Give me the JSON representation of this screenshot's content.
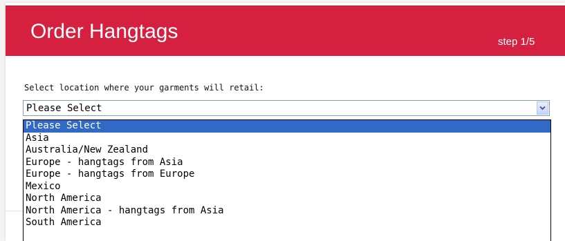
{
  "header": {
    "title": "Order Hangtags",
    "step": "step 1/5"
  },
  "form": {
    "location_label": "Select location where your garments will retail:",
    "location_value": "Please Select"
  },
  "dropdown": {
    "options": [
      {
        "label": "Please Select",
        "selected": true
      },
      {
        "label": "Asia",
        "selected": false
      },
      {
        "label": "Australia/New Zealand",
        "selected": false
      },
      {
        "label": "Europe - hangtags from Asia",
        "selected": false
      },
      {
        "label": "Europe - hangtags from Europe",
        "selected": false
      },
      {
        "label": "Mexico",
        "selected": false
      },
      {
        "label": "North America",
        "selected": false
      },
      {
        "label": "North America - hangtags from Asia",
        "selected": false
      },
      {
        "label": "South America",
        "selected": false
      }
    ]
  },
  "colors": {
    "header_bg": "#d6203f",
    "selection_bg": "#3169c6"
  },
  "icons": {
    "dropdown_arrow": "chevron-down-icon"
  }
}
